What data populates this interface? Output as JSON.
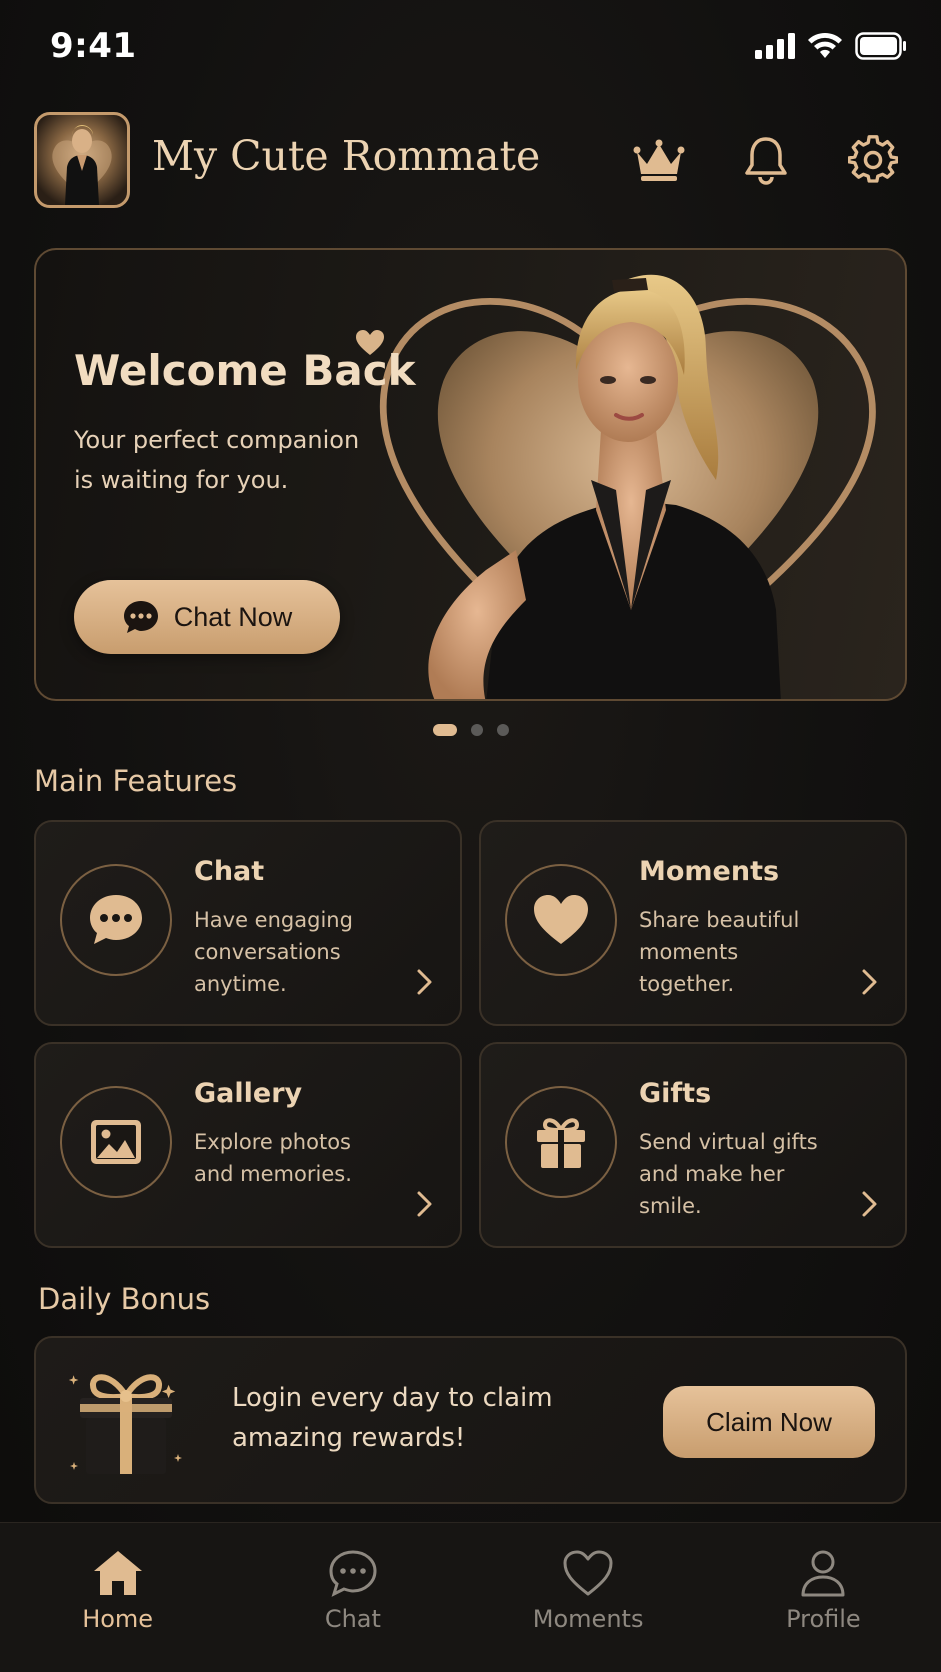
{
  "status_bar": {
    "time": "9:41"
  },
  "header": {
    "app_title": "My Cute Rommate",
    "icons": [
      "crown-icon",
      "bell-icon",
      "gear-icon"
    ]
  },
  "hero": {
    "title": "Welcome Back",
    "subtitle": "Your perfect companion is waiting for you.",
    "cta_label": "Chat Now",
    "carousel_count": 3,
    "carousel_active_index": 0
  },
  "main_features": {
    "title": "Main Features",
    "cards": [
      {
        "title": "Chat",
        "description": "Have engaging conversations anytime.",
        "icon": "chat-bubble-icon"
      },
      {
        "title": "Moments",
        "description": "Share beautiful moments together.",
        "icon": "heart-icon"
      },
      {
        "title": "Gallery",
        "description": "Explore photos and memories.",
        "icon": "image-icon"
      },
      {
        "title": "Gifts",
        "description": "Send virtual gifts and make her smile.",
        "icon": "gift-icon"
      }
    ]
  },
  "daily_bonus": {
    "title": "Daily Bonus",
    "text": "Login every day to claim amazing rewards!",
    "button_label": "Claim Now"
  },
  "tab_bar": {
    "items": [
      {
        "label": "Home",
        "icon": "home-icon",
        "active": true
      },
      {
        "label": "Chat",
        "icon": "chat-bubble-icon",
        "active": false
      },
      {
        "label": "Moments",
        "icon": "heart-icon",
        "active": false
      },
      {
        "label": "Profile",
        "icon": "person-icon",
        "active": false
      }
    ]
  },
  "colors": {
    "background": "#121110",
    "accent_gold": "#e0bb91",
    "card_border": "#3a3127",
    "text_primary": "#ecd3b2",
    "tab_inactive": "#8e8880"
  }
}
